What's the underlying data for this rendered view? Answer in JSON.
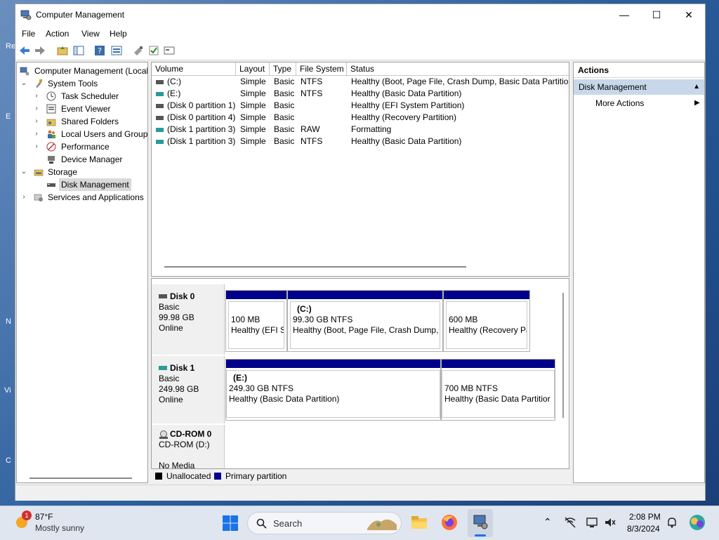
{
  "window": {
    "title": "Computer Management"
  },
  "controls": {
    "minimize": "—",
    "maximize": "☐",
    "close": "✕"
  },
  "menu": [
    "File",
    "Action",
    "View",
    "Help"
  ],
  "tree": {
    "root": "Computer Management (Local",
    "system_tools": "System Tools",
    "task_scheduler": "Task Scheduler",
    "event_viewer": "Event Viewer",
    "shared_folders": "Shared Folders",
    "local_users": "Local Users and Groups",
    "performance": "Performance",
    "device_manager": "Device Manager",
    "storage": "Storage",
    "disk_management": "Disk Management",
    "services": "Services and Applications"
  },
  "volumes": {
    "columns": [
      "Volume",
      "Layout",
      "Type",
      "File System",
      "Status"
    ],
    "rows": [
      {
        "volume": "(C:)",
        "layout": "Simple",
        "type": "Basic",
        "fs": "NTFS",
        "status": "Healthy (Boot, Page File, Crash Dump, Basic Data Partition)"
      },
      {
        "volume": "(E:)",
        "layout": "Simple",
        "type": "Basic",
        "fs": "NTFS",
        "status": "Healthy (Basic Data Partition)"
      },
      {
        "volume": "(Disk 0 partition 1)",
        "layout": "Simple",
        "type": "Basic",
        "fs": "",
        "status": "Healthy (EFI System Partition)"
      },
      {
        "volume": "(Disk 0 partition 4)",
        "layout": "Simple",
        "type": "Basic",
        "fs": "",
        "status": "Healthy (Recovery Partition)"
      },
      {
        "volume": "(Disk 1 partition 3)",
        "layout": "Simple",
        "type": "Basic",
        "fs": "RAW",
        "status": "Formatting"
      },
      {
        "volume": "(Disk 1 partition 3)",
        "layout": "Simple",
        "type": "Basic",
        "fs": "NTFS",
        "status": "Healthy (Basic Data Partition)"
      }
    ]
  },
  "disks": {
    "disk0": {
      "name": "Disk 0",
      "kind": "Basic",
      "size": "99.98 GB",
      "state": "Online",
      "partitions": [
        {
          "label": "",
          "size": "100 MB",
          "status": "Healthy (EFI S"
        },
        {
          "label": "(C:)",
          "size": "99.30 GB NTFS",
          "status": "Healthy (Boot, Page File, Crash Dump, I"
        },
        {
          "label": "",
          "size": "600 MB",
          "status": "Healthy (Recovery Pa"
        }
      ]
    },
    "disk1": {
      "name": "Disk 1",
      "kind": "Basic",
      "size": "249.98 GB",
      "state": "Online",
      "partitions": [
        {
          "label": "(E:)",
          "size": "249.30 GB NTFS",
          "status": "Healthy (Basic Data Partition)"
        },
        {
          "label": "",
          "size": "700 MB NTFS",
          "status": "Healthy (Basic Data Partitior"
        }
      ]
    },
    "cdrom": {
      "name": "CD-ROM 0",
      "drive": "CD-ROM (D:)",
      "media": "No Media"
    }
  },
  "legend": {
    "unallocated": "Unallocated",
    "primary": "Primary partition"
  },
  "actions": {
    "header": "Actions",
    "section": "Disk Management",
    "more": "More Actions"
  },
  "taskbar": {
    "weather_temp": "87°F",
    "weather_desc": "Mostly sunny",
    "weather_badge": "1",
    "search_placeholder": "Search",
    "time": "2:08 PM",
    "date": "8/3/2024"
  },
  "colors": {
    "primary_partition": "#00008b",
    "unallocated": "#000000",
    "selection": "#c8d8ea"
  }
}
